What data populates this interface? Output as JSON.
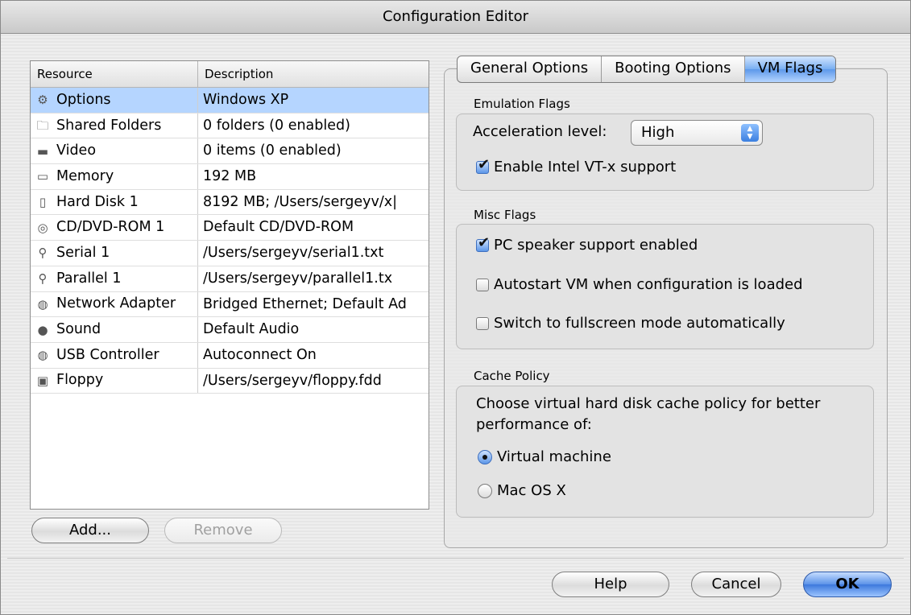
{
  "window": {
    "title": "Configuration Editor"
  },
  "resources": {
    "headers": {
      "resource": "Resource",
      "description": "Description"
    },
    "rows": [
      {
        "icon": "gear-icon",
        "glyph": "⚙",
        "name": "Options",
        "description": "Windows XP",
        "selected": true
      },
      {
        "icon": "shared-folder-icon",
        "glyph": "🗀",
        "name": "Shared Folders",
        "description": "0 folders (0 enabled)"
      },
      {
        "icon": "monitor-icon",
        "glyph": "▬",
        "name": "Video",
        "description": "0 items (0 enabled)"
      },
      {
        "icon": "memory-icon",
        "glyph": "▭",
        "name": "Memory",
        "description": "192 MB"
      },
      {
        "icon": "hard-disk-icon",
        "glyph": "▯",
        "name": "Hard Disk 1",
        "description": "8192 MB; /Users/sergeyv/x|"
      },
      {
        "icon": "cd-icon",
        "glyph": "◎",
        "name": "CD/DVD-ROM 1",
        "description": "Default CD/DVD-ROM"
      },
      {
        "icon": "serial-port-icon",
        "glyph": "⚲",
        "name": "Serial 1",
        "description": "/Users/sergeyv/serial1.txt"
      },
      {
        "icon": "parallel-port-icon",
        "glyph": "⚲",
        "name": "Parallel 1",
        "description": "/Users/sergeyv/parallel1.tx"
      },
      {
        "icon": "network-globe-icon",
        "glyph": "◍",
        "name": "Network Adapter",
        "description": "Bridged Ethernet; Default Ad"
      },
      {
        "icon": "speaker-icon",
        "glyph": "●",
        "name": "Sound",
        "description": "Default Audio"
      },
      {
        "icon": "usb-icon",
        "glyph": "◍",
        "name": "USB Controller",
        "description": "Autoconnect On"
      },
      {
        "icon": "floppy-icon",
        "glyph": "▣",
        "name": "Floppy",
        "description": "/Users/sergeyv/floppy.fdd"
      }
    ]
  },
  "list_buttons": {
    "add": "Add...",
    "remove": "Remove"
  },
  "tabs": [
    "General Options",
    "Booting Options",
    "VM Flags"
  ],
  "active_tab": "VM Flags",
  "emulation": {
    "title": "Emulation Flags",
    "acceleration_label": "Acceleration level:",
    "acceleration_value": "High",
    "vtx_label": "Enable Intel VT-x support",
    "vtx_checked": true
  },
  "misc": {
    "title": "Misc Flags",
    "pc_speaker": {
      "label": "PC speaker support enabled",
      "checked": true
    },
    "autostart": {
      "label": "Autostart VM when configuration is loaded",
      "checked": false
    },
    "fullscreen": {
      "label": "Switch to fullscreen mode automatically",
      "checked": false
    }
  },
  "cache": {
    "title": "Cache Policy",
    "description_line1": "Choose virtual hard disk cache policy for better",
    "description_line2": "performance of:",
    "options": [
      {
        "label": "Virtual machine",
        "selected": true
      },
      {
        "label": "Mac OS X",
        "selected": false
      }
    ]
  },
  "dialog_buttons": {
    "help": "Help",
    "cancel": "Cancel",
    "ok": "OK"
  },
  "colors": {
    "selection": "#b5d5ff",
    "accent": "#3c78dc"
  }
}
